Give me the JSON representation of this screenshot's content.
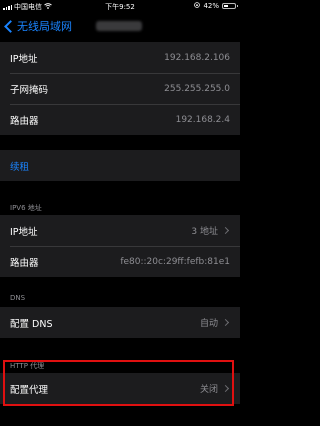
{
  "status_bar": {
    "carrier": "中国电信",
    "time": "下午9:52",
    "battery": "42%",
    "battery_level": 0.42
  },
  "nav": {
    "back_label": "无线局域网"
  },
  "ipv4": {
    "rows": [
      {
        "label": "IP地址",
        "value": "192.168.2.106"
      },
      {
        "label": "子网掩码",
        "value": "255.255.255.0"
      },
      {
        "label": "路由器",
        "value": "192.168.2.4"
      }
    ]
  },
  "lease": {
    "label": "续租"
  },
  "ipv6": {
    "header": "IPV6 地址",
    "rows": [
      {
        "label": "IP地址",
        "value": "3 地址"
      },
      {
        "label": "路由器",
        "value": "fe80::20c:29ff:fefb:81e1"
      }
    ]
  },
  "dns": {
    "header": "DNS",
    "row": {
      "label": "配置 DNS",
      "value": "自动"
    }
  },
  "proxy": {
    "header": "HTTP 代理",
    "row": {
      "label": "配置代理",
      "value": "关闭"
    }
  },
  "colors": {
    "accent": "#1a84ff",
    "highlight": "#e01010",
    "cell_background": "#1c1c1e"
  }
}
